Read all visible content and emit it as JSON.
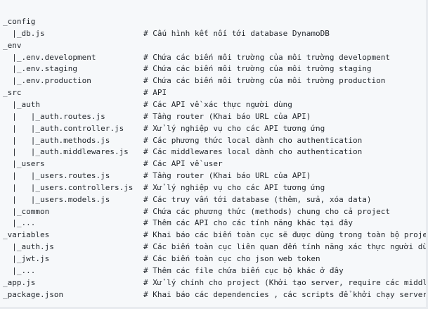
{
  "code": {
    "lines": [
      {
        "tree": "_config",
        "comment": ""
      },
      {
        "tree": "  |_db.js",
        "comment": "# Cấu hình kết nối tới database DynamoDB"
      },
      {
        "tree": "_env",
        "comment": ""
      },
      {
        "tree": "  |_.env.development",
        "comment": "# Chứa các biến môi trường của môi trường development"
      },
      {
        "tree": "  |_.env.staging",
        "comment": "# Chứa các biến môi trường của môi trường staging"
      },
      {
        "tree": "  |_.env.production",
        "comment": "# Chứa các biến môi trường của môi trường production"
      },
      {
        "tree": "_src",
        "comment": "# API"
      },
      {
        "tree": "  |_auth",
        "comment": "# Các API về xác thực người dùng"
      },
      {
        "tree": "  |   |_auth.routes.js",
        "comment": "# Tầng router (Khai báo URL của API)"
      },
      {
        "tree": "  |   |_auth.controller.js",
        "comment": "# Xử lý nghiệp vụ cho các API tương ứng"
      },
      {
        "tree": "  |   |_auth.methods.js",
        "comment": "# Các phương thức local dành cho authentication"
      },
      {
        "tree": "  |   |_auth.middlewares.js",
        "comment": "# Các middlewares local dành cho authentication"
      },
      {
        "tree": "  |_users",
        "comment": "# Các API về user"
      },
      {
        "tree": "  |   |_users.routes.js",
        "comment": "# Tầng router (Khai báo URL của API)"
      },
      {
        "tree": "  |   |_users.controllers.js",
        "comment": "# Xử lý nghiệp vụ cho các API tương ứng"
      },
      {
        "tree": "  |   |_users.models.js",
        "comment": "# Các truy vấn tới database (thêm, sửa, xóa data)"
      },
      {
        "tree": "  |_common",
        "comment": "# Chứa các phương thức (methods) chung cho cả project"
      },
      {
        "tree": "  |_...",
        "comment": "# Thêm các API cho các tính năng khác tại đây"
      },
      {
        "tree": "_variables",
        "comment": "# Khai báo các biến toàn cục sẽ được dùng trong toàn bộ project"
      },
      {
        "tree": "  |_auth.js",
        "comment": "# Các biến toàn cục liên quan đến tính năng xác thực người dùng"
      },
      {
        "tree": "  |_jwt.js",
        "comment": "# Các biến toàn cục cho json web token"
      },
      {
        "tree": "  |_...",
        "comment": "# Thêm các file chứa biến cục bộ khác ở đây"
      },
      {
        "tree": "_app.js",
        "comment": "# Xử lý chính cho project (Khởi tạo server, require các middlewares"
      },
      {
        "tree": "_package.json",
        "comment": "# Khai báo các dependencies , các scripts để khởi chạy server"
      }
    ]
  }
}
